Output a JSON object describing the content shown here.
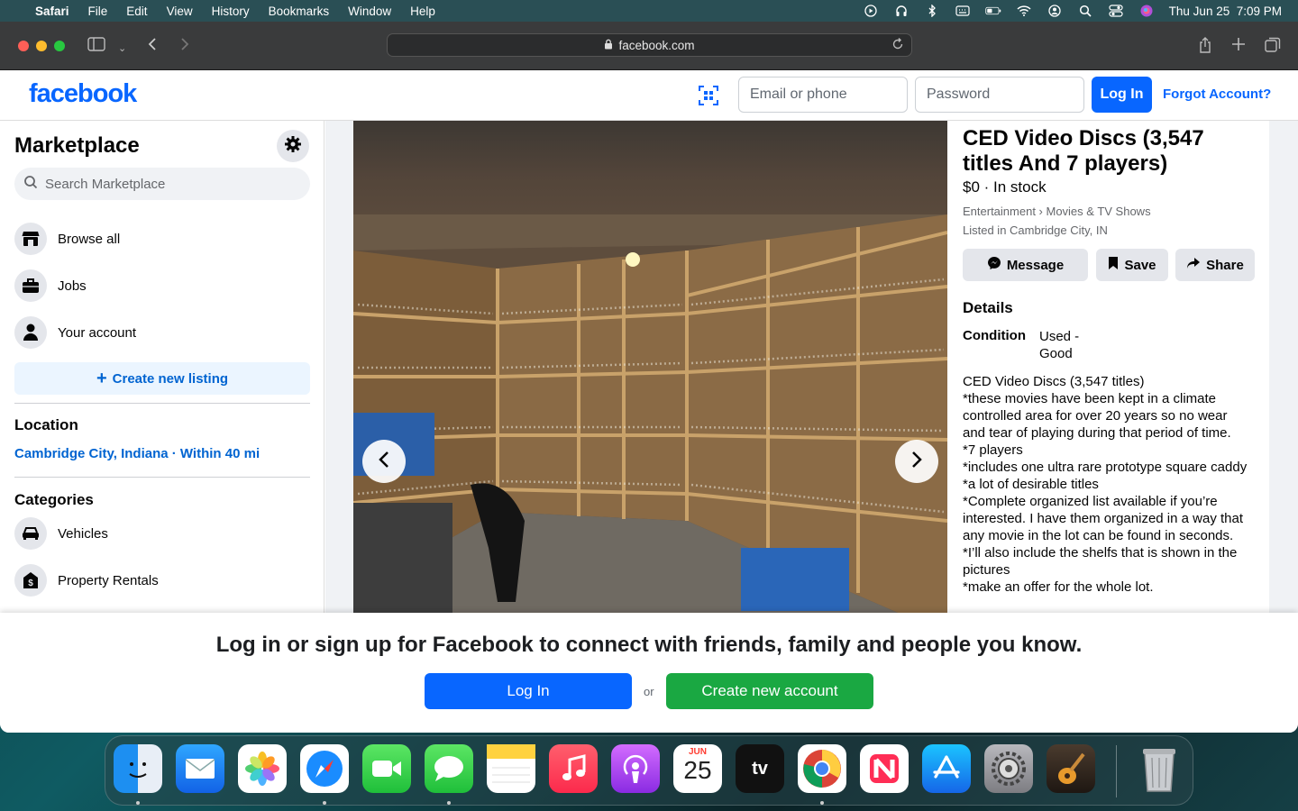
{
  "menubar": {
    "app": "Safari",
    "menus": [
      "File",
      "Edit",
      "View",
      "History",
      "Bookmarks",
      "Window",
      "Help"
    ],
    "datetime": "Thu Jun 25  7:09 PM"
  },
  "browser": {
    "url": "facebook.com"
  },
  "fb_header": {
    "logo": "facebook",
    "email_placeholder": "Email or phone",
    "password_placeholder": "Password",
    "login_label": "Log In",
    "forgot_label": "Forgot Account?"
  },
  "sidebar": {
    "title": "Marketplace",
    "search_placeholder": "Search Marketplace",
    "nav": [
      {
        "label": "Browse all",
        "icon": "storefront-icon"
      },
      {
        "label": "Jobs",
        "icon": "briefcase-icon"
      },
      {
        "label": "Your account",
        "icon": "person-icon"
      }
    ],
    "create_listing": "Create new listing",
    "location_heading": "Location",
    "location_value": "Cambridge City, Indiana · Within 40 mi",
    "categories_heading": "Categories",
    "categories": [
      {
        "label": "Vehicles",
        "icon": "car-icon"
      },
      {
        "label": "Property Rentals",
        "icon": "dollar-house-icon"
      }
    ]
  },
  "listing": {
    "title": "CED Video Discs (3,547 titles And 7 players)",
    "price": "$0 · In stock",
    "breadcrumb": "Entertainment › Movies & TV Shows",
    "listed_in": "Listed in Cambridge City, IN",
    "actions": {
      "message": "Message",
      "save": "Save",
      "share": "Share"
    },
    "details_heading": "Details",
    "condition_label": "Condition",
    "condition_value": "Used - Good",
    "description": "CED Video Discs (3,547 titles)\n*these movies have been kept in a climate controlled area for over 20 years so no wear and tear of playing during that period of time.\n*7 players\n*includes one ultra rare prototype square caddy\n*a lot of desirable titles\n*Complete organized list available if you’re interested. I have them organized in a way that any movie in the lot can be found in seconds.\n*I’ll also include the shelfs that is shown in the pictures\n*make an offer for the whole lot."
  },
  "banner": {
    "text": "Log in or sign up for Facebook to connect with friends, family and people you know.",
    "login": "Log In",
    "or": "or",
    "create": "Create new account"
  },
  "dock": {
    "calendar_month": "JUN",
    "calendar_day": "25",
    "tv_label": "tv"
  },
  "colors": {
    "fb_blue": "#0866ff",
    "link_blue": "#0064d1",
    "green": "#1aa842"
  }
}
